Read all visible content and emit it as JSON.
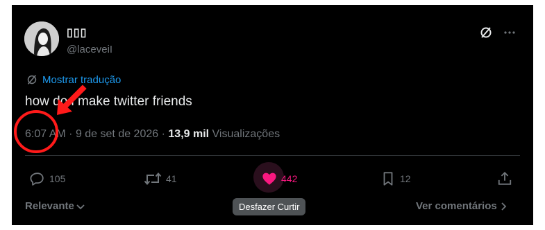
{
  "user": {
    "display_name": "▯▯▯",
    "handle": "@laceveiI"
  },
  "translate": {
    "label": "Mostrar tradução"
  },
  "tweet": {
    "text": "how do i make twitter friends",
    "time": "6:07 AM",
    "date": "9 de set de 2026",
    "views_count": "13,9 mil",
    "views_label": "Visualizações"
  },
  "actions": {
    "replies": "105",
    "retweets": "41",
    "likes": "442",
    "bookmarks": "12"
  },
  "footer": {
    "sort_label": "Relevante",
    "view_replies_label": "Ver comentários"
  },
  "tooltip": {
    "text": "Desfazer Curtir"
  },
  "colors": {
    "background": "#000000",
    "text": "#e7e9ea",
    "muted": "#71767b",
    "link": "#1d9bf0",
    "like": "#f91880",
    "annotation": "#ff1a1a"
  },
  "icons": {
    "translate": "no-translate-icon",
    "more": "more-horizontal-icon",
    "reply": "reply-icon",
    "retweet": "retweet-icon",
    "like": "heart-filled-icon",
    "bookmark": "bookmark-icon",
    "share": "share-icon"
  }
}
